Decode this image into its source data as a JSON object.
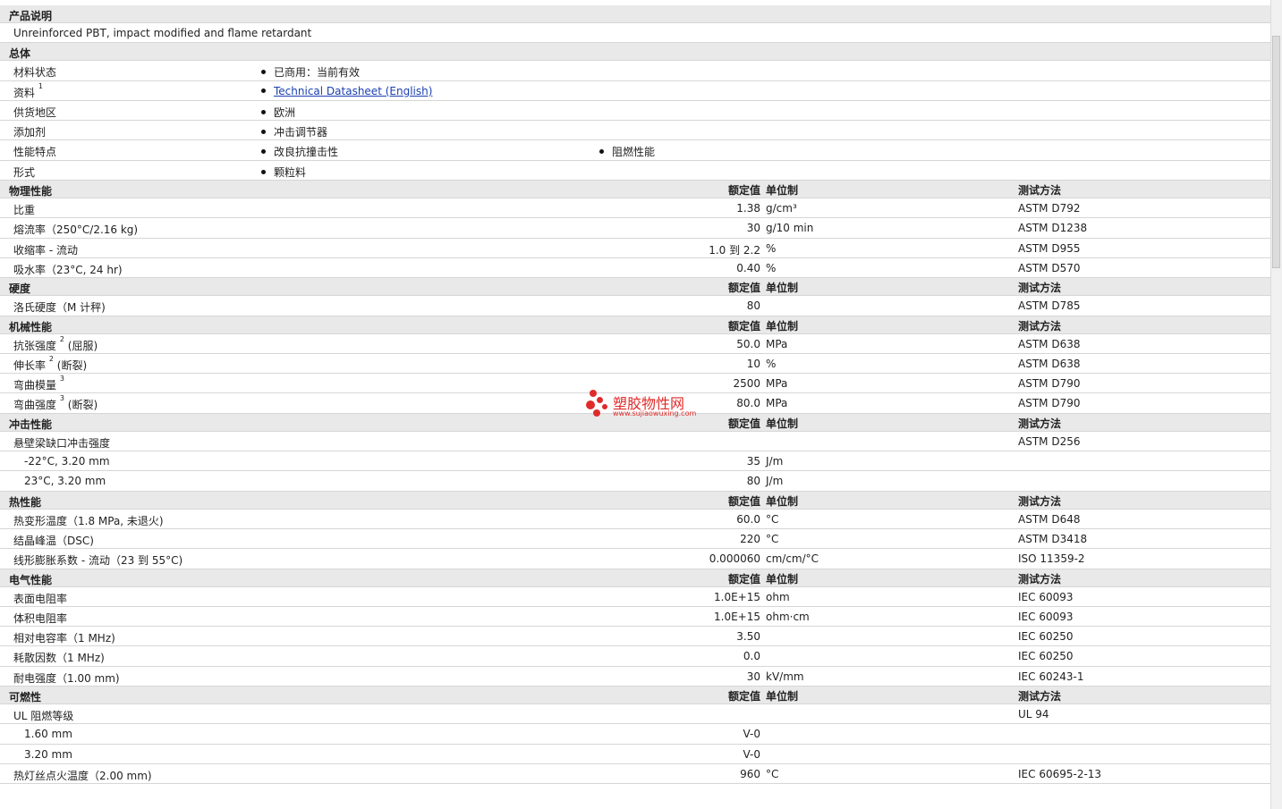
{
  "sections": [
    {
      "title": "产品说明",
      "kind": "text",
      "rows": [
        {
          "label": "Unreinforced PBT, impact modified and flame retardant"
        }
      ]
    },
    {
      "title": "总体",
      "kind": "bullets",
      "rows": [
        {
          "label": "材料状态",
          "b1": "已商用：当前有效"
        },
        {
          "label": "资料",
          "sup": "1",
          "b1": "Technical Datasheet (English)",
          "link": true
        },
        {
          "label": "供货地区",
          "b1": "欧洲"
        },
        {
          "label": "添加剂",
          "b1": "冲击调节器"
        },
        {
          "label": "性能特点",
          "b1": "改良抗撞击性",
          "b2": "阻燃性能"
        },
        {
          "label": "形式",
          "b1": "颗粒料"
        }
      ]
    },
    {
      "title": "物理性能",
      "kind": "data",
      "rows": [
        {
          "label": "比重",
          "value": "1.38",
          "unit": "g/cm³",
          "method": "ASTM D792"
        },
        {
          "label": "熔流率（250°C/2.16 kg)",
          "value": "30",
          "unit": "g/10 min",
          "method": "ASTM D1238"
        },
        {
          "label": "收缩率 - 流动",
          "value": "1.0 到  2.2",
          "unit": "%",
          "method": "ASTM D955"
        },
        {
          "label": "吸水率（23°C, 24 hr)",
          "value": "0.40",
          "unit": "%",
          "method": "ASTM D570"
        }
      ]
    },
    {
      "title": "硬度",
      "kind": "data",
      "rows": [
        {
          "label": "洛氏硬度（M 计秤)",
          "value": "80",
          "unit": "",
          "method": "ASTM D785"
        }
      ]
    },
    {
      "title": "机械性能",
      "kind": "data",
      "rows": [
        {
          "label": "抗张强度",
          "sup": "2",
          "suffix": "(屈服)",
          "value": "50.0",
          "unit": "MPa",
          "method": "ASTM D638"
        },
        {
          "label": "伸长率",
          "sup": "2",
          "suffix": "(断裂)",
          "value": "10",
          "unit": "%",
          "method": "ASTM D638"
        },
        {
          "label": "弯曲模量",
          "sup": "3",
          "value": "2500",
          "unit": "MPa",
          "method": "ASTM D790"
        },
        {
          "label": "弯曲强度",
          "sup": "3",
          "suffix": "(断裂)",
          "value": "80.0",
          "unit": "MPa",
          "method": "ASTM D790"
        }
      ]
    },
    {
      "title": "冲击性能",
      "kind": "data",
      "rows": [
        {
          "label": "悬壁梁缺口冲击强度",
          "value": "",
          "unit": "",
          "method": "ASTM D256"
        },
        {
          "label": "-22°C, 3.20 mm",
          "indent": true,
          "value": "35",
          "unit": "J/m",
          "method": ""
        },
        {
          "label": "23°C, 3.20 mm",
          "indent": true,
          "value": "80",
          "unit": "J/m",
          "method": ""
        }
      ]
    },
    {
      "title": "热性能",
      "kind": "data",
      "rows": [
        {
          "label": "热变形温度（1.8 MPa, 未退火)",
          "value": "60.0",
          "unit": "°C",
          "method": "ASTM D648"
        },
        {
          "label": "结晶峰温（DSC)",
          "value": "220",
          "unit": "°C",
          "method": "ASTM D3418"
        },
        {
          "label": "线形膨胀系数 - 流动（23 到  55°C)",
          "value": "0.000060",
          "unit": "cm/cm/°C",
          "method": "ISO 11359-2"
        }
      ]
    },
    {
      "title": "电气性能",
      "kind": "data",
      "rows": [
        {
          "label": "表面电阻率",
          "value": "1.0E+15",
          "unit": "ohm",
          "method": "IEC 60093"
        },
        {
          "label": "体积电阻率",
          "value": "1.0E+15",
          "unit": "ohm·cm",
          "method": "IEC 60093"
        },
        {
          "label": "相对电容率（1 MHz)",
          "value": "3.50",
          "unit": "",
          "method": "IEC 60250"
        },
        {
          "label": "耗散因数（1 MHz)",
          "value": "0.0",
          "unit": "",
          "method": "IEC 60250"
        },
        {
          "label": "耐电强度（1.00 mm)",
          "value": "30",
          "unit": "kV/mm",
          "method": "IEC 60243-1"
        }
      ]
    },
    {
      "title": "可燃性",
      "kind": "data",
      "rows": [
        {
          "label": "UL 阻燃等级",
          "value": "",
          "unit": "",
          "method": "UL 94"
        },
        {
          "label": "1.60 mm",
          "indent": true,
          "value": "V-0",
          "unit": "",
          "method": ""
        },
        {
          "label": "3.20 mm",
          "indent": true,
          "value": "V-0",
          "unit": "",
          "method": ""
        },
        {
          "label": "热灯丝点火温度（2.00 mm)",
          "value": "960",
          "unit": "°C",
          "method": "IEC 60695-2-13"
        }
      ]
    }
  ],
  "header_labels": {
    "value": "额定值",
    "unit": "单位制",
    "method": "测试方法"
  },
  "watermark": {
    "title": "塑胶物性网",
    "url": "www.sujiaowuxing.com"
  }
}
